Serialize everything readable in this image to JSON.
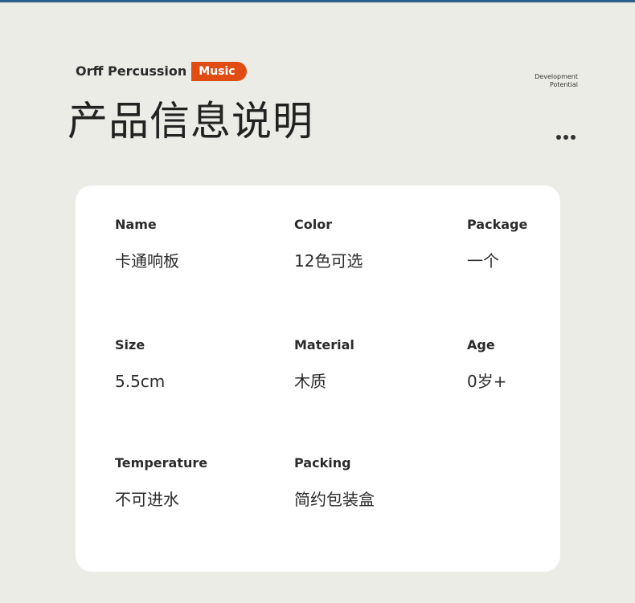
{
  "header": {
    "brand": "Orff Percussion",
    "badge": "Music",
    "corner_line1": "Development",
    "corner_line2": "Potential",
    "title": "产品信息说明",
    "more_icon": "ellipsis-icon"
  },
  "specs": [
    {
      "label": "Name",
      "value": "卡通响板"
    },
    {
      "label": "Color",
      "value": "12色可选"
    },
    {
      "label": "Package",
      "value": "一个"
    },
    {
      "label": "Size",
      "value": "5.5cm"
    },
    {
      "label": "Material",
      "value": "木质"
    },
    {
      "label": "Age",
      "value": "0岁+"
    },
    {
      "label": "Temperature",
      "value": "不可进水"
    },
    {
      "label": "Packing",
      "value": "简约包装盒"
    }
  ],
  "colors": {
    "accent": "#e04c12",
    "top_bar": "#2e5f8a",
    "background": "#ecece7",
    "card": "#ffffff"
  }
}
